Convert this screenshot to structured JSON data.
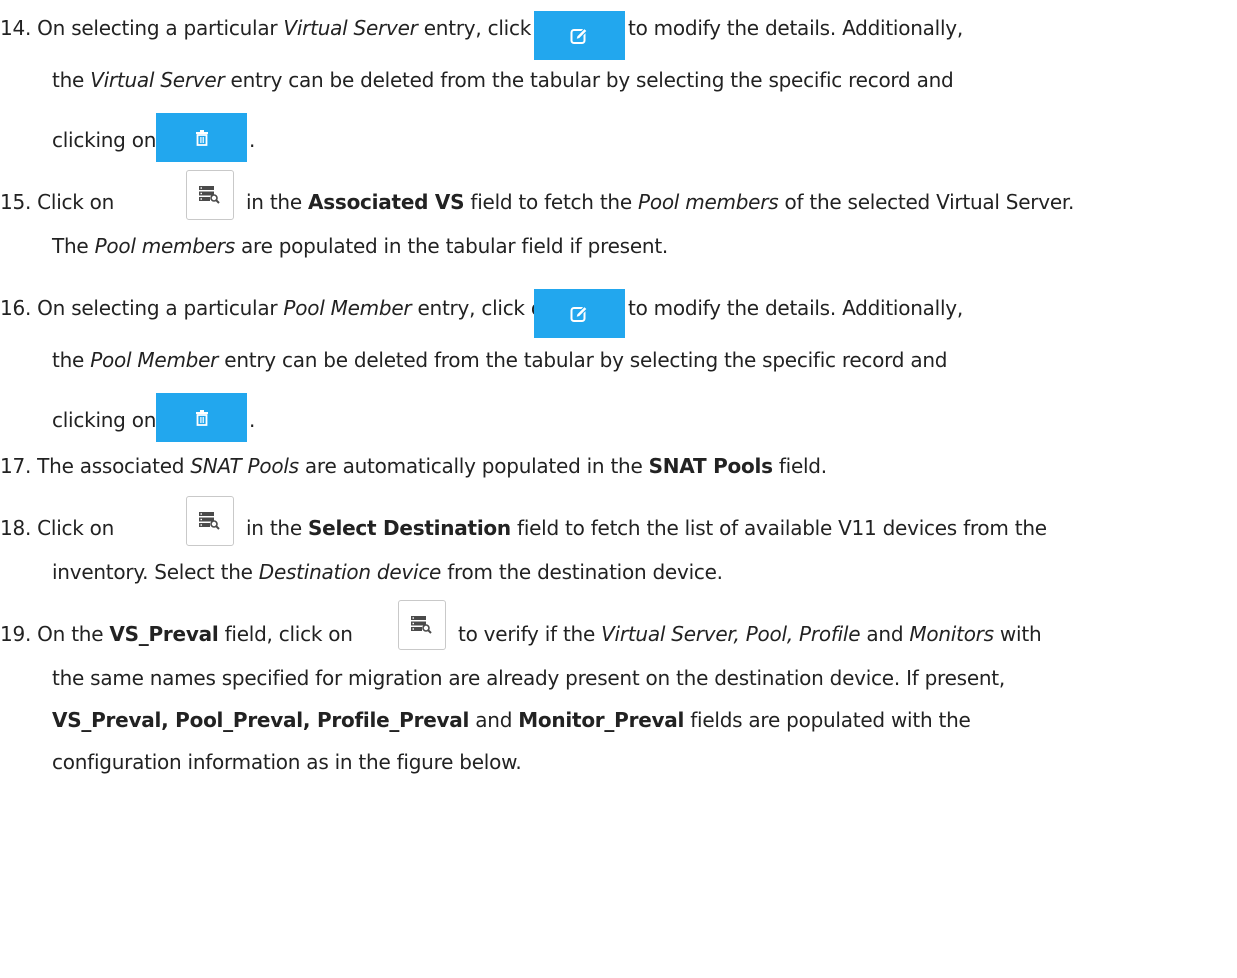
{
  "steps": [
    {
      "number": "14.",
      "lines": [
        {
          "t1": "On selecting a particular ",
          "i1": "Virtual Server",
          "t2": " entry, click on",
          "t3": "to modify the details. Additionally,"
        },
        {
          "t1": "the ",
          "i1": "Virtual Server",
          "t2": " entry can be deleted from the tabular by selecting the specific record and"
        },
        {
          "t1": "clicking on",
          "t2": "."
        }
      ],
      "icons": [
        "edit-icon",
        "trash-icon"
      ]
    },
    {
      "number": "15.",
      "lines": [
        {
          "t1": "Click on",
          "t2": "in the ",
          "b1": "Associated VS",
          "t3": " field to fetch the ",
          "i1": "Pool members",
          "t4": " of the selected Virtual Server."
        },
        {
          "t1": "The ",
          "i1": "Pool members",
          "t2": " are populated in the tabular field if present."
        }
      ],
      "icons": [
        "server-search-icon"
      ]
    },
    {
      "number": "16.",
      "lines": [
        {
          "t1": "On selecting a particular ",
          "i1": "Pool Member",
          "t2": " entry, click on",
          "t3": "to modify the details. Additionally,"
        },
        {
          "t1": "the ",
          "i1": "Pool Member",
          "t2": " entry can be deleted from the tabular by selecting the specific record and"
        },
        {
          "t1": "clicking on",
          "t2": "."
        }
      ],
      "icons": [
        "edit-icon",
        "trash-icon"
      ]
    },
    {
      "number": "17.",
      "lines": [
        {
          "t1": "The associated ",
          "i1": "SNAT Pools",
          "t2": " are automatically populated in the ",
          "b1": "SNAT Pools",
          "t3": " field."
        }
      ]
    },
    {
      "number": "18.",
      "lines": [
        {
          "t1": "Click on",
          "t2": "in the ",
          "b1": "Select Destination",
          "t3": " field to fetch the list of available V11 devices from the"
        },
        {
          "t1": "inventory. Select the ",
          "i1": "Destination device",
          "t2": " from the destination device."
        }
      ],
      "icons": [
        "server-search-icon"
      ]
    },
    {
      "number": "19.",
      "lines": [
        {
          "t1": "On the ",
          "b1": "VS_Preval",
          "t2": " field, click on",
          "t3": "to verify if the ",
          "i1": "Virtual Server, Pool, Profile",
          "t4": " and ",
          "i2": "Monitors",
          "t5": " with"
        },
        {
          "t1": "the same names specified for migration are already present on the destination device. If present,"
        },
        {
          "b1": "VS_Preval, Pool_Preval, Profile_Preval",
          "t1": " and ",
          "b2": "Monitor_Preval",
          "t2": " fields are populated with the"
        },
        {
          "t1": "configuration information as in the figure below."
        }
      ],
      "icons": [
        "server-search-icon"
      ]
    }
  ],
  "colors": {
    "button_blue": "#22a7ee",
    "text": "#222222",
    "button_border": "#c9c9c9"
  }
}
